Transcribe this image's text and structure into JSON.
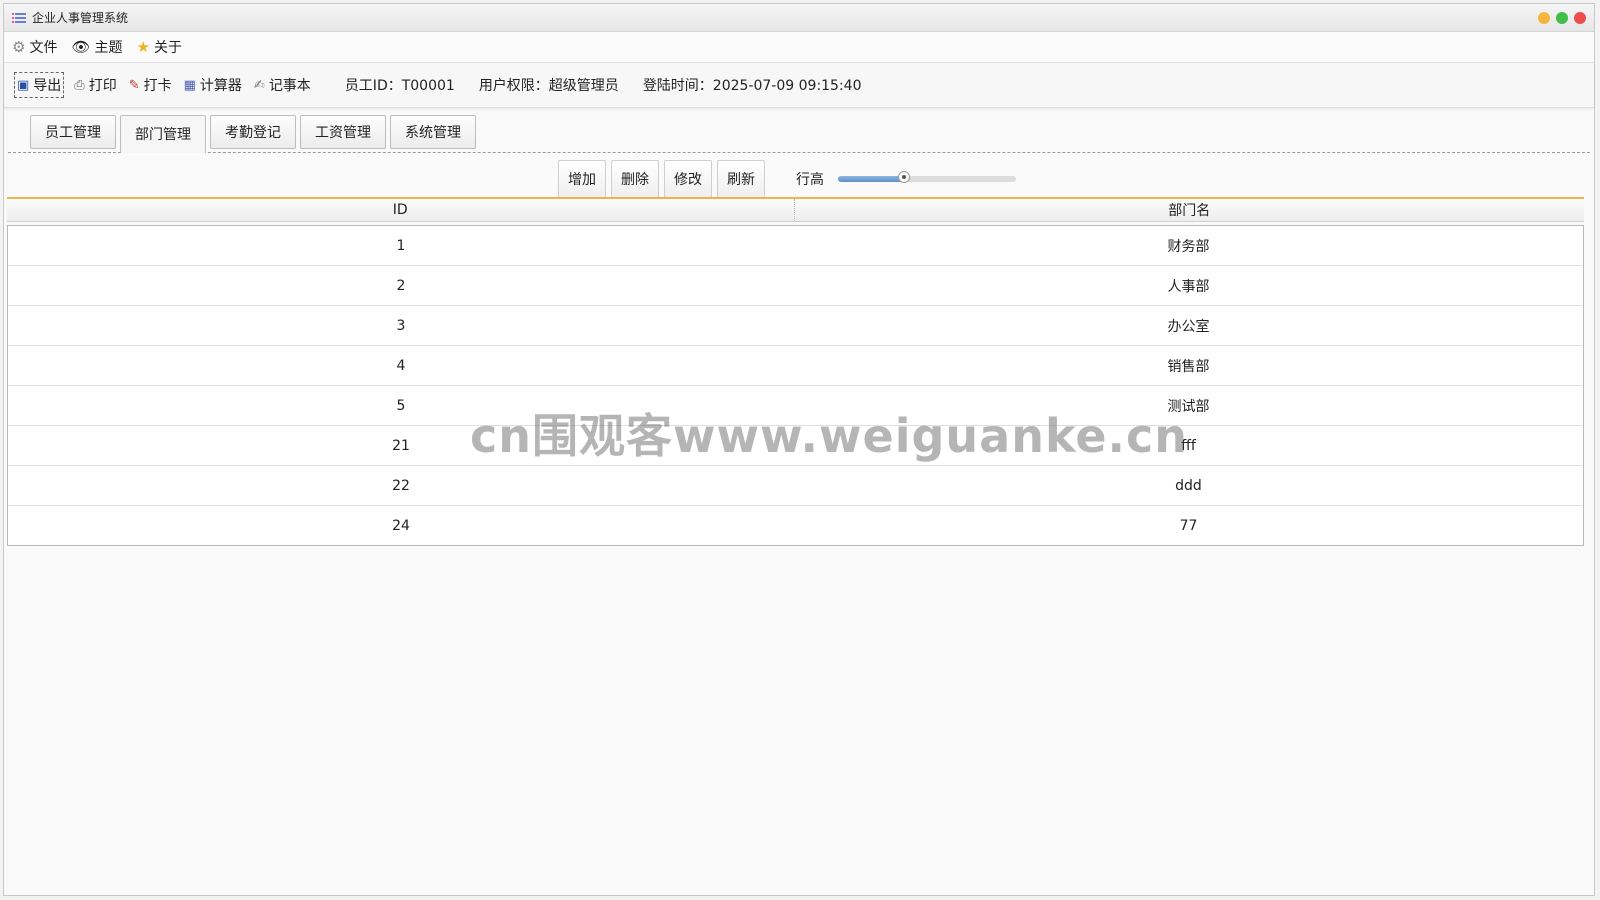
{
  "window": {
    "title": "企业人事管理系统",
    "controls": [
      {
        "name": "minimize",
        "color": "#f5b73b"
      },
      {
        "name": "maximize",
        "color": "#3fbf4a"
      },
      {
        "name": "close",
        "color": "#ee4b4b"
      }
    ]
  },
  "menu": [
    {
      "label": "文件",
      "icon": "gear-icon"
    },
    {
      "label": "主题",
      "icon": "eye-icon"
    },
    {
      "label": "关于",
      "icon": "star-icon"
    }
  ],
  "toolbar": {
    "buttons": [
      {
        "label": "导出",
        "icon": "save-icon"
      },
      {
        "label": "打印",
        "icon": "printer-icon"
      },
      {
        "label": "打卡",
        "icon": "checkin-icon"
      },
      {
        "label": "计算器",
        "icon": "calculator-icon"
      },
      {
        "label": "记事本",
        "icon": "notepad-icon"
      }
    ],
    "employee_id": "员工ID：T00001",
    "permission": "用户权限：超级管理员",
    "login_time": "登陆时间：2025-07-09 09:15:40"
  },
  "tabs": [
    {
      "label": "员工管理",
      "active": false
    },
    {
      "label": "部门管理",
      "active": true
    },
    {
      "label": "考勤登记",
      "active": false
    },
    {
      "label": "工资管理",
      "active": false
    },
    {
      "label": "系统管理",
      "active": false
    }
  ],
  "actions": {
    "add": "增加",
    "delete": "删除",
    "edit": "修改",
    "refresh": "刷新",
    "row_height_label": "行高",
    "row_height_value": 0.37
  },
  "table": {
    "headers": [
      "ID",
      "部门名"
    ],
    "rows": [
      [
        "1",
        "财务部"
      ],
      [
        "2",
        "人事部"
      ],
      [
        "3",
        "办公室"
      ],
      [
        "4",
        "销售部"
      ],
      [
        "5",
        "测试部"
      ],
      [
        "21",
        "fff"
      ],
      [
        "22",
        "ddd"
      ],
      [
        "24",
        "77"
      ]
    ]
  },
  "watermark": "cn围观客www.weiguanke.cn",
  "accent_color": "#f2b34a"
}
